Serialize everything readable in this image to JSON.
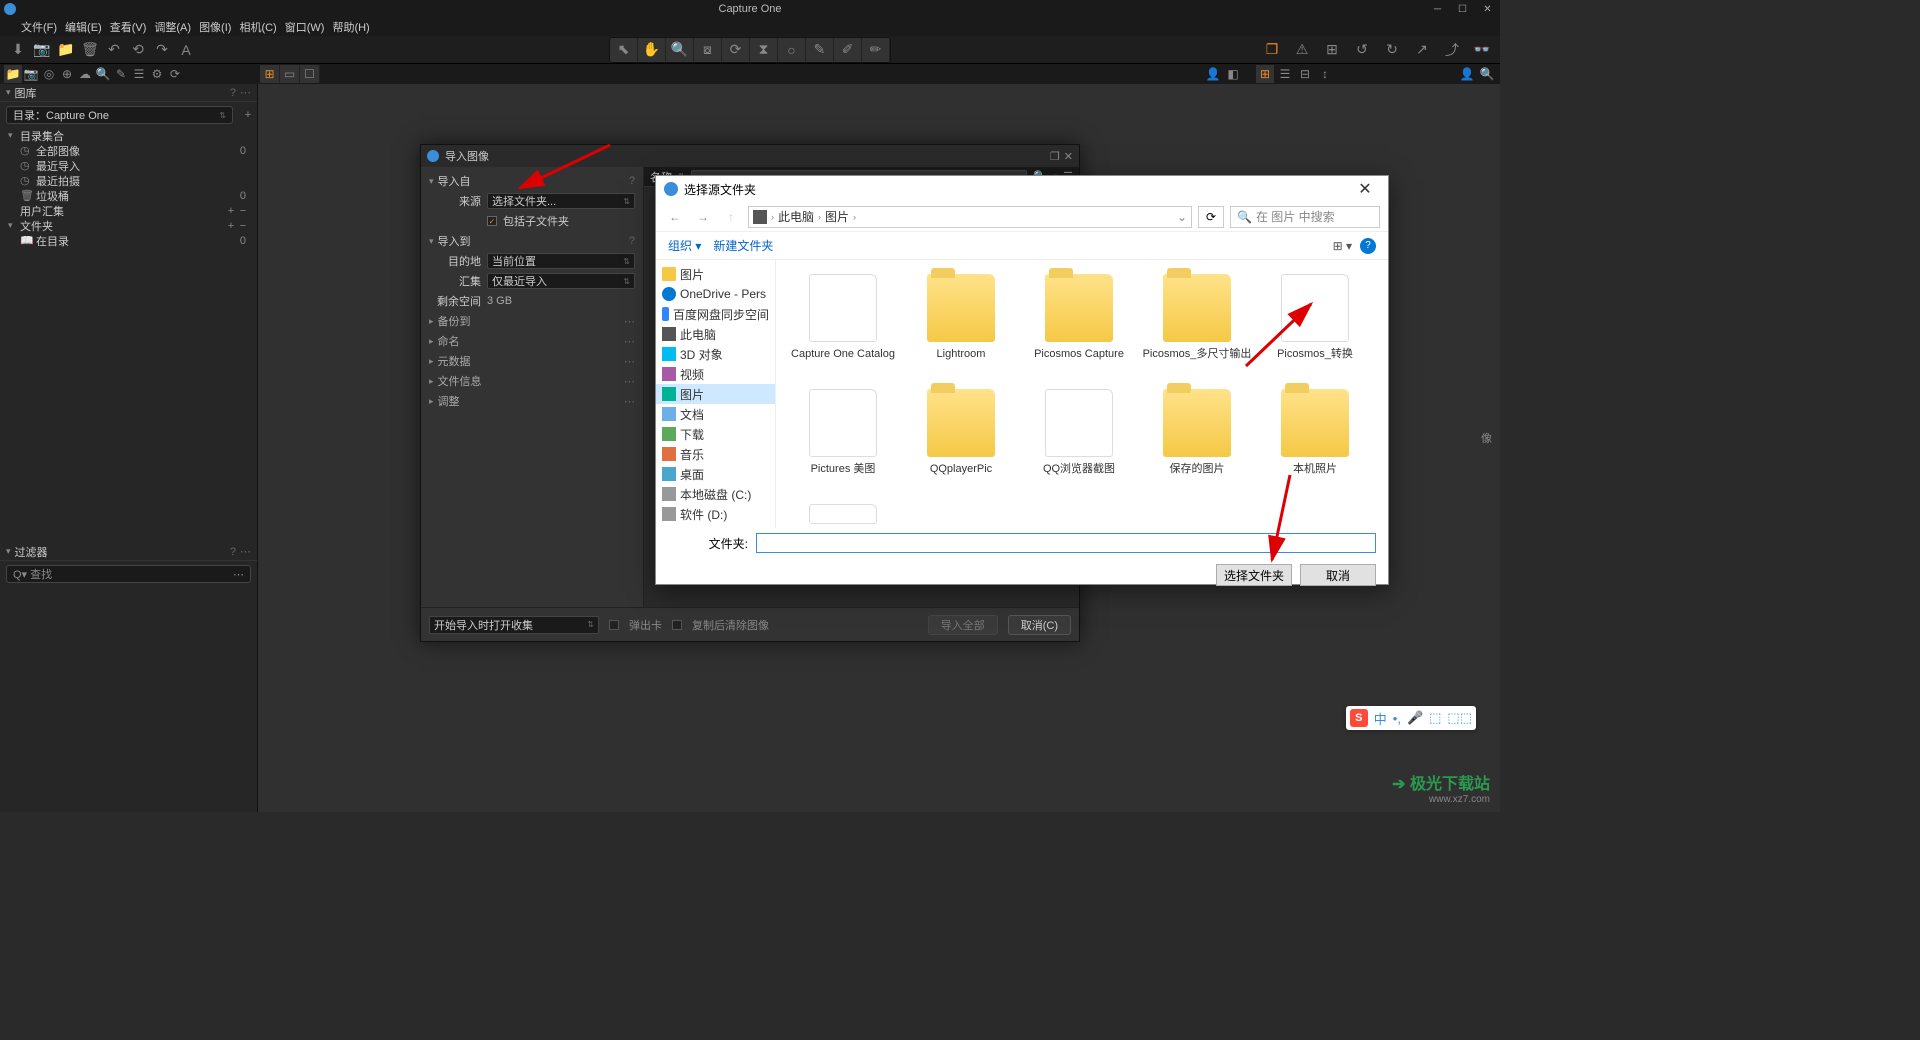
{
  "app": {
    "title": "Capture One"
  },
  "menu": [
    "文件(F)",
    "编辑(E)",
    "查看(V)",
    "调整(A)",
    "图像(I)",
    "相机(C)",
    "窗口(W)",
    "帮助(H)"
  ],
  "sidebar": {
    "lib_title": "图库",
    "catalog_label": "目录：Capture One",
    "group1": {
      "title": "目录集合",
      "items": [
        {
          "label": "全部图像",
          "count": "0"
        },
        {
          "label": "最近导入",
          "count": ""
        },
        {
          "label": "最近拍摄",
          "count": ""
        },
        {
          "label": "垃圾桶",
          "count": "0"
        }
      ]
    },
    "group2": {
      "title": "用户汇集"
    },
    "group3": {
      "title": "文件夹",
      "item": {
        "label": "在目录",
        "count": "0"
      }
    },
    "filter_title": "过滤器",
    "search_placeholder": "Q▾ 查找"
  },
  "import_dialog": {
    "title": "导入图像",
    "from": {
      "title": "导入自",
      "source_label": "来源",
      "source_value": "选择文件夹...",
      "sub_label": "包括子文件夹"
    },
    "to": {
      "title": "导入到",
      "dest_label": "目的地",
      "dest_value": "当前位置",
      "collect_label": "汇集",
      "collect_value": "仅最近导入",
      "space_label": "剩余空间",
      "space_value": "3 GB"
    },
    "collapsed": [
      "备份到",
      "命名",
      "元数据",
      "文件信息",
      "调整"
    ],
    "name_col": "名称",
    "bottom": {
      "auto_open": "开始导入时打开收集",
      "eject": "弹出卡",
      "clear": "复制后清除图像",
      "import_all": "导入全部",
      "cancel": "取消(C)"
    }
  },
  "win_dialog": {
    "title": "选择源文件夹",
    "nav": {
      "pc": "此电脑",
      "pics": "图片"
    },
    "search_ph": "在 图片 中搜索",
    "tools": {
      "org": "组织 ▾",
      "newf": "新建文件夹"
    },
    "tree": [
      {
        "label": "图片",
        "cls": "folder"
      },
      {
        "label": "OneDrive - Pers",
        "cls": "cloud"
      },
      {
        "label": "百度网盘同步空间",
        "cls": "baidu"
      },
      {
        "label": "此电脑",
        "cls": "pc"
      },
      {
        "label": "3D 对象",
        "cls": "obj"
      },
      {
        "label": "视频",
        "cls": "vid"
      },
      {
        "label": "图片",
        "cls": "pic",
        "selected": true
      },
      {
        "label": "文档",
        "cls": "doc"
      },
      {
        "label": "下载",
        "cls": "dl"
      },
      {
        "label": "音乐",
        "cls": "music"
      },
      {
        "label": "桌面",
        "cls": "desk"
      },
      {
        "label": "本地磁盘 (C:)",
        "cls": "disk"
      },
      {
        "label": "软件 (D:)",
        "cls": "disk"
      }
    ],
    "folders_r1": [
      {
        "name": "Capture One Catalog",
        "img": true
      },
      {
        "name": "Lightroom",
        "img": false
      },
      {
        "name": "Picosmos Capture",
        "img": false
      },
      {
        "name": "Picosmos_多尺寸输出",
        "img": false
      },
      {
        "name": "Picosmos_转换",
        "img": true
      }
    ],
    "folders_r2": [
      {
        "name": "Pictures 美图",
        "img": true
      },
      {
        "name": "QQplayerPic",
        "img": false
      },
      {
        "name": "QQ浏览器截图",
        "img": true
      },
      {
        "name": "保存的图片",
        "img": false
      },
      {
        "name": "本机照片",
        "img": false
      }
    ],
    "path_label": "文件夹:",
    "select_btn": "选择文件夹",
    "cancel_btn": "取消"
  },
  "viewer_hint": "像",
  "ime": {
    "logo": "S",
    "items": [
      "中",
      "•,",
      "🎤",
      "⬚",
      "⬚⬚"
    ]
  },
  "watermark": {
    "brand": "极光下载站",
    "url": "www.xz7.com"
  }
}
